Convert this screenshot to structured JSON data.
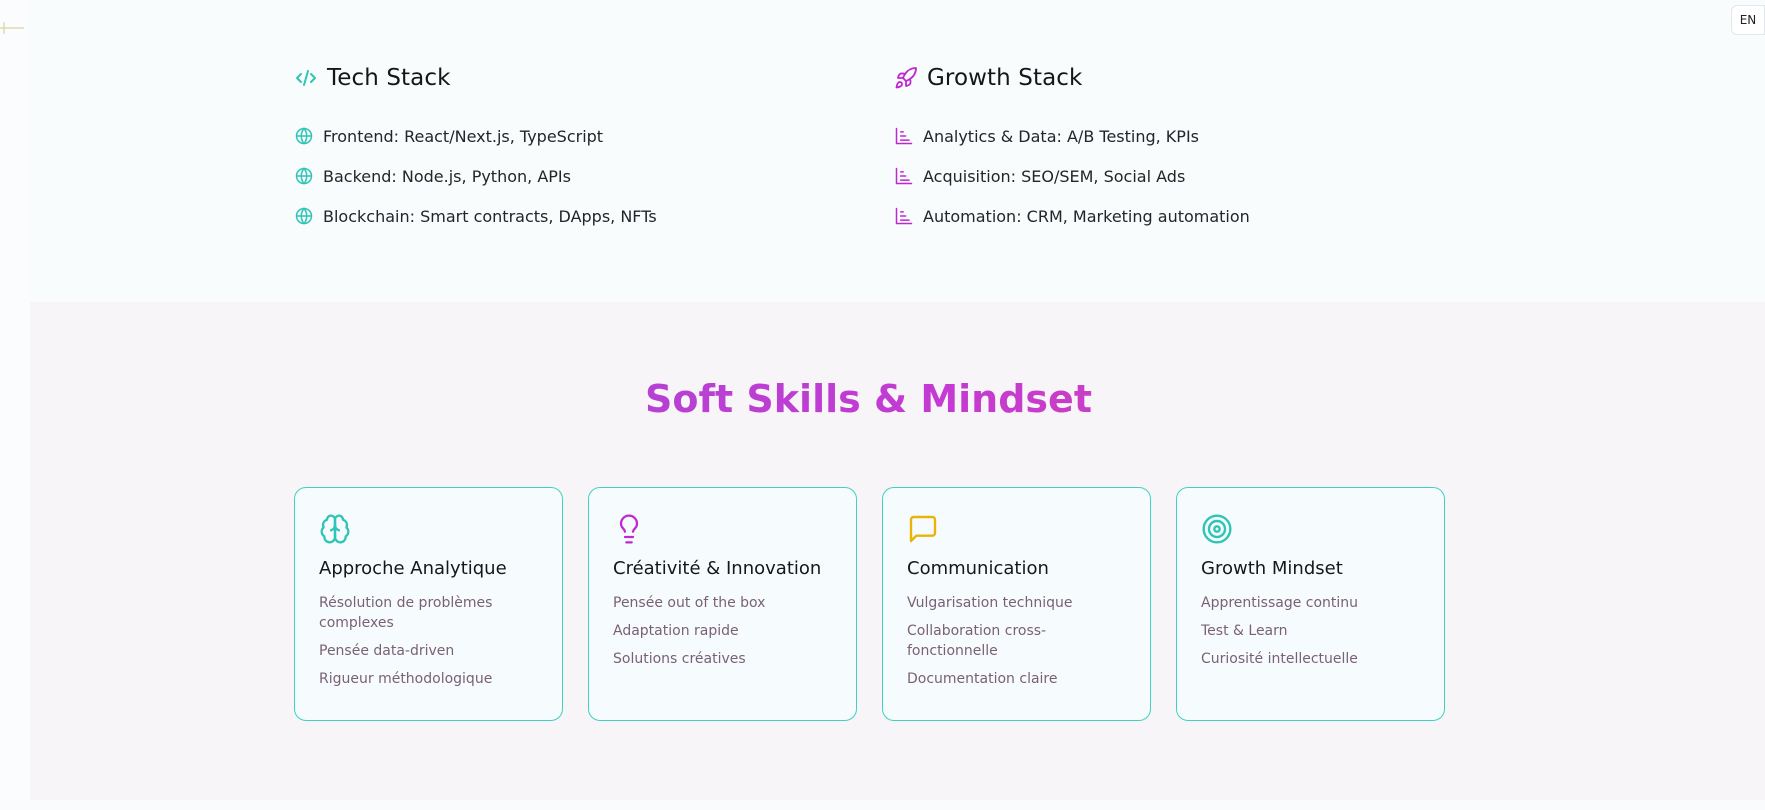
{
  "header": {
    "language_button": "EN"
  },
  "tech_stack": {
    "title": "Tech Stack",
    "icon": "code-icon",
    "items": [
      {
        "label": "Frontend: React/Next.js, TypeScript",
        "icon": "globe-icon"
      },
      {
        "label": "Backend: Node.js, Python, APIs",
        "icon": "globe-icon"
      },
      {
        "label": "Blockchain: Smart contracts, DApps, NFTs",
        "icon": "globe-icon"
      }
    ]
  },
  "growth_stack": {
    "title": "Growth Stack",
    "icon": "rocket-icon",
    "items": [
      {
        "label": "Analytics & Data: A/B Testing, KPIs",
        "icon": "bar-chart-icon"
      },
      {
        "label": "Acquisition: SEO/SEM, Social Ads",
        "icon": "bar-chart-icon"
      },
      {
        "label": "Automation: CRM, Marketing automation",
        "icon": "bar-chart-icon"
      }
    ]
  },
  "soft_skills": {
    "title": "Soft Skills & Mindset",
    "cards": [
      {
        "title": "Approche Analytique",
        "icon": "brain-icon",
        "icon_color": "#2ec4b6",
        "items": [
          "Résolution de problèmes complexes",
          "Pensée data-driven",
          "Rigueur méthodologique"
        ]
      },
      {
        "title": "Créativité & Innovation",
        "icon": "lightbulb-icon",
        "icon_color": "#c026d3",
        "items": [
          "Pensée out of the box",
          "Adaptation rapide",
          "Solutions créatives"
        ]
      },
      {
        "title": "Communication",
        "icon": "message-square-icon",
        "icon_color": "#eab308",
        "items": [
          "Vulgarisation technique",
          "Collaboration cross-fonctionnelle",
          "Documentation claire"
        ]
      },
      {
        "title": "Growth Mindset",
        "icon": "target-icon",
        "icon_color": "#2ec4b6",
        "items": [
          "Apprentissage continu",
          "Test & Learn",
          "Curiosité intellectuelle"
        ]
      }
    ]
  },
  "colors": {
    "teal": "#2ec4b6",
    "magenta": "#c026d3",
    "yellow": "#eab308",
    "card_border": "#3fd2c0"
  }
}
